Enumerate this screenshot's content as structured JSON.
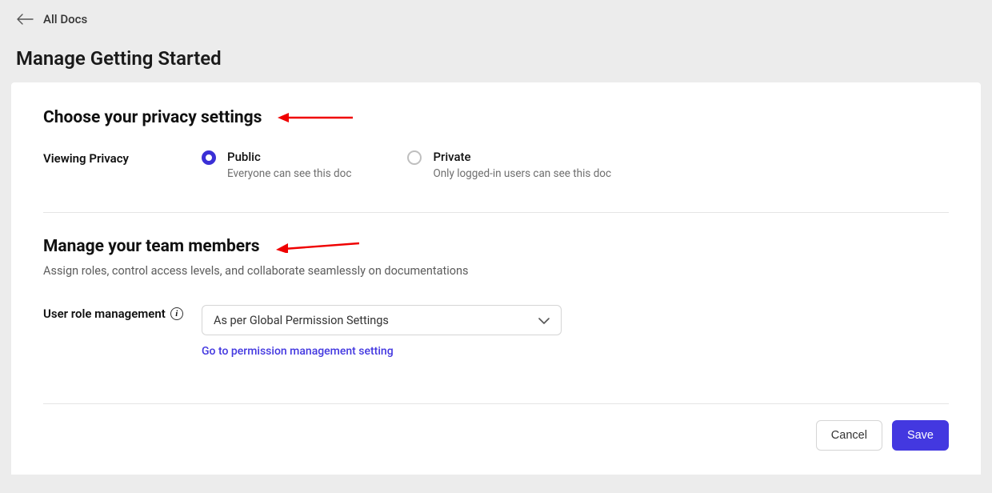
{
  "breadcrumb": {
    "back_label": "All Docs"
  },
  "page": {
    "title": "Manage Getting Started"
  },
  "privacy": {
    "section_title": "Choose your privacy settings",
    "row_label": "Viewing Privacy",
    "options": [
      {
        "label": "Public",
        "desc": "Everyone can see this doc",
        "selected": true
      },
      {
        "label": "Private",
        "desc": "Only logged-in users can see this doc",
        "selected": false
      }
    ]
  },
  "team": {
    "section_title": "Manage your team members",
    "subtitle": "Assign roles, control access levels, and collaborate seamlessly on documentations",
    "role_row_label": "User role management",
    "role_select_value": "As per Global Permission Settings",
    "permission_link": "Go to permission management setting"
  },
  "actions": {
    "cancel": "Cancel",
    "save": "Save"
  }
}
